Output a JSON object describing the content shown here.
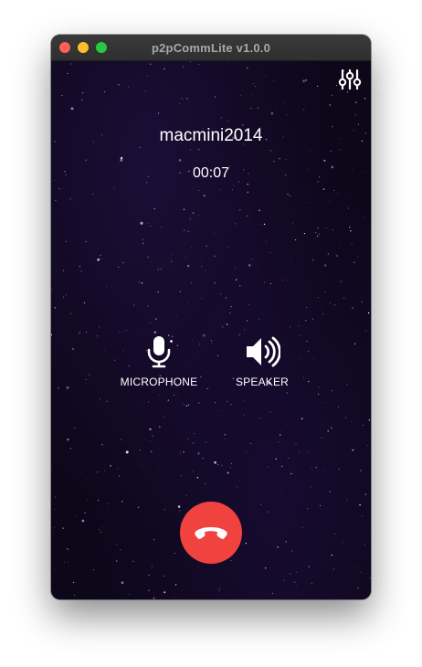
{
  "window": {
    "title": "p2pCommLite v1.0.0",
    "controls": [
      "close",
      "minimize",
      "maximize"
    ]
  },
  "call": {
    "peer_name": "macmini2014",
    "duration": "00:07"
  },
  "controls": {
    "microphone": {
      "label": "MICROPHONE",
      "icon": "microphone-icon"
    },
    "speaker": {
      "label": "SPEAKER",
      "icon": "speaker-icon"
    },
    "settings": {
      "icon": "sliders-icon"
    },
    "hangup": {
      "icon": "phone-hangup-icon",
      "color": "#f0433f"
    }
  },
  "theme": {
    "background": "#0c0719",
    "text": "#ffffff"
  }
}
